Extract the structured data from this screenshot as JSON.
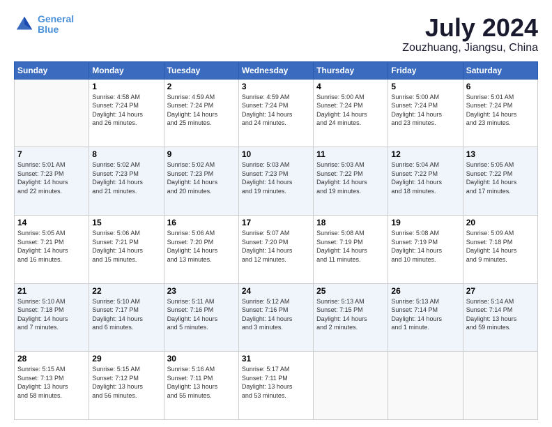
{
  "logo": {
    "line1": "General",
    "line2": "Blue"
  },
  "title": "July 2024",
  "subtitle": "Zouzhuang, Jiangsu, China",
  "days_header": [
    "Sunday",
    "Monday",
    "Tuesday",
    "Wednesday",
    "Thursday",
    "Friday",
    "Saturday"
  ],
  "weeks": [
    [
      {
        "day": "",
        "info": ""
      },
      {
        "day": "1",
        "info": "Sunrise: 4:58 AM\nSunset: 7:24 PM\nDaylight: 14 hours\nand 26 minutes."
      },
      {
        "day": "2",
        "info": "Sunrise: 4:59 AM\nSunset: 7:24 PM\nDaylight: 14 hours\nand 25 minutes."
      },
      {
        "day": "3",
        "info": "Sunrise: 4:59 AM\nSunset: 7:24 PM\nDaylight: 14 hours\nand 24 minutes."
      },
      {
        "day": "4",
        "info": "Sunrise: 5:00 AM\nSunset: 7:24 PM\nDaylight: 14 hours\nand 24 minutes."
      },
      {
        "day": "5",
        "info": "Sunrise: 5:00 AM\nSunset: 7:24 PM\nDaylight: 14 hours\nand 23 minutes."
      },
      {
        "day": "6",
        "info": "Sunrise: 5:01 AM\nSunset: 7:24 PM\nDaylight: 14 hours\nand 23 minutes."
      }
    ],
    [
      {
        "day": "7",
        "info": "Sunrise: 5:01 AM\nSunset: 7:23 PM\nDaylight: 14 hours\nand 22 minutes."
      },
      {
        "day": "8",
        "info": "Sunrise: 5:02 AM\nSunset: 7:23 PM\nDaylight: 14 hours\nand 21 minutes."
      },
      {
        "day": "9",
        "info": "Sunrise: 5:02 AM\nSunset: 7:23 PM\nDaylight: 14 hours\nand 20 minutes."
      },
      {
        "day": "10",
        "info": "Sunrise: 5:03 AM\nSunset: 7:23 PM\nDaylight: 14 hours\nand 19 minutes."
      },
      {
        "day": "11",
        "info": "Sunrise: 5:03 AM\nSunset: 7:22 PM\nDaylight: 14 hours\nand 19 minutes."
      },
      {
        "day": "12",
        "info": "Sunrise: 5:04 AM\nSunset: 7:22 PM\nDaylight: 14 hours\nand 18 minutes."
      },
      {
        "day": "13",
        "info": "Sunrise: 5:05 AM\nSunset: 7:22 PM\nDaylight: 14 hours\nand 17 minutes."
      }
    ],
    [
      {
        "day": "14",
        "info": "Sunrise: 5:05 AM\nSunset: 7:21 PM\nDaylight: 14 hours\nand 16 minutes."
      },
      {
        "day": "15",
        "info": "Sunrise: 5:06 AM\nSunset: 7:21 PM\nDaylight: 14 hours\nand 15 minutes."
      },
      {
        "day": "16",
        "info": "Sunrise: 5:06 AM\nSunset: 7:20 PM\nDaylight: 14 hours\nand 13 minutes."
      },
      {
        "day": "17",
        "info": "Sunrise: 5:07 AM\nSunset: 7:20 PM\nDaylight: 14 hours\nand 12 minutes."
      },
      {
        "day": "18",
        "info": "Sunrise: 5:08 AM\nSunset: 7:19 PM\nDaylight: 14 hours\nand 11 minutes."
      },
      {
        "day": "19",
        "info": "Sunrise: 5:08 AM\nSunset: 7:19 PM\nDaylight: 14 hours\nand 10 minutes."
      },
      {
        "day": "20",
        "info": "Sunrise: 5:09 AM\nSunset: 7:18 PM\nDaylight: 14 hours\nand 9 minutes."
      }
    ],
    [
      {
        "day": "21",
        "info": "Sunrise: 5:10 AM\nSunset: 7:18 PM\nDaylight: 14 hours\nand 7 minutes."
      },
      {
        "day": "22",
        "info": "Sunrise: 5:10 AM\nSunset: 7:17 PM\nDaylight: 14 hours\nand 6 minutes."
      },
      {
        "day": "23",
        "info": "Sunrise: 5:11 AM\nSunset: 7:16 PM\nDaylight: 14 hours\nand 5 minutes."
      },
      {
        "day": "24",
        "info": "Sunrise: 5:12 AM\nSunset: 7:16 PM\nDaylight: 14 hours\nand 3 minutes."
      },
      {
        "day": "25",
        "info": "Sunrise: 5:13 AM\nSunset: 7:15 PM\nDaylight: 14 hours\nand 2 minutes."
      },
      {
        "day": "26",
        "info": "Sunrise: 5:13 AM\nSunset: 7:14 PM\nDaylight: 14 hours\nand 1 minute."
      },
      {
        "day": "27",
        "info": "Sunrise: 5:14 AM\nSunset: 7:14 PM\nDaylight: 13 hours\nand 59 minutes."
      }
    ],
    [
      {
        "day": "28",
        "info": "Sunrise: 5:15 AM\nSunset: 7:13 PM\nDaylight: 13 hours\nand 58 minutes."
      },
      {
        "day": "29",
        "info": "Sunrise: 5:15 AM\nSunset: 7:12 PM\nDaylight: 13 hours\nand 56 minutes."
      },
      {
        "day": "30",
        "info": "Sunrise: 5:16 AM\nSunset: 7:11 PM\nDaylight: 13 hours\nand 55 minutes."
      },
      {
        "day": "31",
        "info": "Sunrise: 5:17 AM\nSunset: 7:11 PM\nDaylight: 13 hours\nand 53 minutes."
      },
      {
        "day": "",
        "info": ""
      },
      {
        "day": "",
        "info": ""
      },
      {
        "day": "",
        "info": ""
      }
    ]
  ]
}
